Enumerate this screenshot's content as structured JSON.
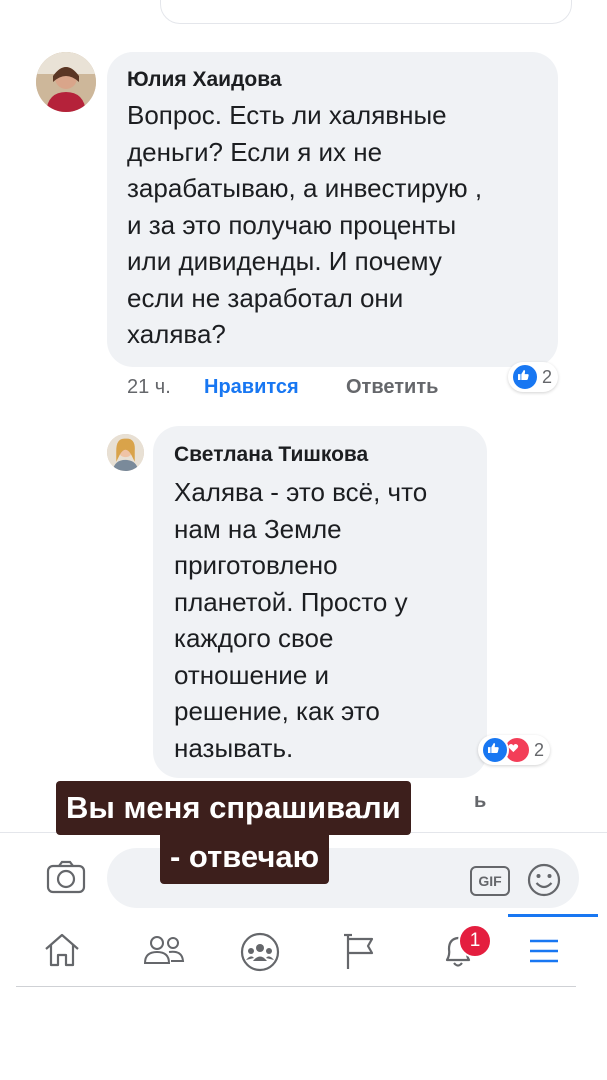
{
  "comments": [
    {
      "author": "Юлия Хаидова",
      "text": "Вопрос. Есть ли халявные\nденьги? Если я их не\nзарабатываю, а инвестирую ,\nи за это получаю проценты\nили дивиденды. И почему\nесли не заработал они\nхалява?",
      "time": "21 ч.",
      "like_label": "Нравится",
      "reply_label": "Ответить",
      "reaction_count": "2",
      "reactions": [
        "like"
      ]
    },
    {
      "author": "Светлана Тишкова",
      "text": "Халява - это всё, что\nнам на Земле\nприготовлено\nпланетой. Просто у\nкаждого свое\nотношение и\nрешение, как это\nназывать.",
      "reply_fragment": "ь",
      "reaction_count": "2",
      "reactions": [
        "like",
        "love"
      ]
    }
  ],
  "overlay": {
    "line1": "Вы меня спрашивали",
    "line2": "- отвечаю"
  },
  "composer": {
    "gif_label": "GIF"
  },
  "nav": {
    "notifications_badge": "1",
    "items": [
      "home",
      "friends",
      "groups",
      "pages",
      "notifications",
      "menu"
    ]
  },
  "colors": {
    "accent": "#1877f2",
    "bubble": "#f0f2f5",
    "overlay_bg": "#3d1f1c",
    "love": "#f33e58",
    "badge": "#e41e3f"
  }
}
